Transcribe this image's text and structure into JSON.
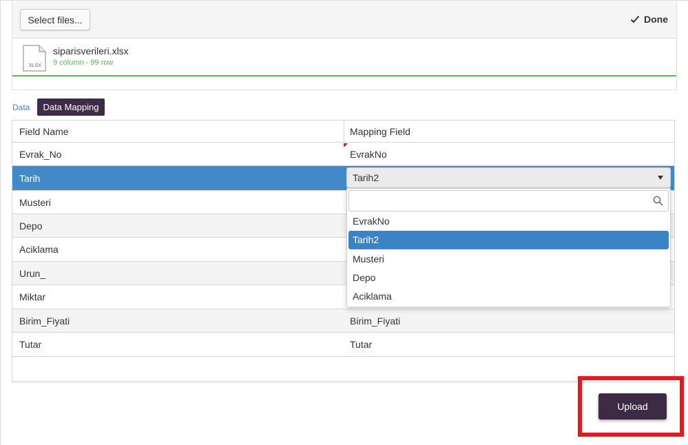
{
  "upload": {
    "select_label": "Select files...",
    "done_label": "Done",
    "file": {
      "name": "siparisverileri.xlsx",
      "ext": ".XLSX",
      "meta": "9 column - 99 row"
    }
  },
  "tabs": [
    {
      "label": "Data",
      "active": false
    },
    {
      "label": "Data Mapping",
      "active": true
    }
  ],
  "grid": {
    "columns": [
      "Field Name",
      "Mapping Field"
    ],
    "rows": [
      {
        "field": "Evrak_No",
        "mapping": "EvrakNo"
      },
      {
        "field": "Tarih",
        "mapping": "Tarih2"
      },
      {
        "field": "Musteri",
        "mapping": ""
      },
      {
        "field": "Depo",
        "mapping": ""
      },
      {
        "field": "Aciklama",
        "mapping": ""
      },
      {
        "field": "Urun_",
        "mapping": ""
      },
      {
        "field": "Miktar",
        "mapping": ""
      },
      {
        "field": "Birim_Fiyati",
        "mapping": "Birim_Fiyati"
      },
      {
        "field": "Tutar",
        "mapping": "Tutar"
      }
    ]
  },
  "dropdown": {
    "value": "Tarih2",
    "search_placeholder": "",
    "options": [
      "EvrakNo",
      "Tarih2",
      "Musteri",
      "Depo",
      "Aciklama"
    ],
    "selected_index": 1
  },
  "upload_button": {
    "label": "Upload"
  },
  "colors": {
    "accent": "#3e2b47",
    "selection": "#4189c8",
    "success": "#5cb85c",
    "highlight": "#e8191e"
  }
}
